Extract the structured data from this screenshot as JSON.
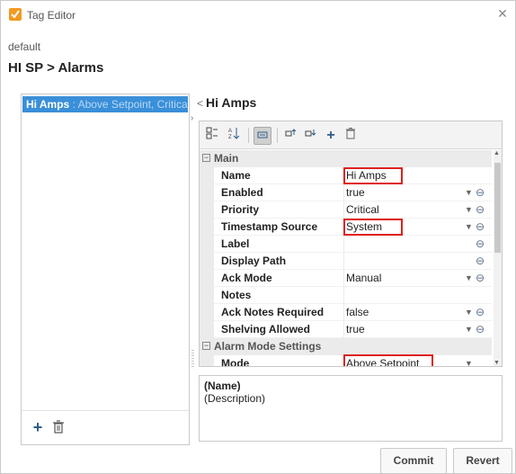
{
  "window": {
    "title": "Tag Editor",
    "close": "✕"
  },
  "path": "default",
  "heading": "HI SP > Alarms",
  "alarms": [
    {
      "name": "Hi Amps",
      "desc": " : Above Setpoint, Critical"
    }
  ],
  "right_title": {
    "arrow": "<",
    "label": "Hi Amps"
  },
  "grid": {
    "main_label": "Main",
    "alarm_mode_label": "Alarm Mode Settings",
    "props": [
      {
        "name": "Name",
        "value": "Hi Amps",
        "dropdown": false,
        "link": false
      },
      {
        "name": "Enabled",
        "value": "true",
        "dropdown": true,
        "link": true
      },
      {
        "name": "Priority",
        "value": "Critical",
        "dropdown": true,
        "link": true
      },
      {
        "name": "Timestamp Source",
        "value": "System",
        "dropdown": true,
        "link": true
      },
      {
        "name": "Label",
        "value": "",
        "dropdown": false,
        "link": true
      },
      {
        "name": "Display Path",
        "value": "",
        "dropdown": false,
        "link": true
      },
      {
        "name": "Ack Mode",
        "value": "Manual",
        "dropdown": true,
        "link": true
      },
      {
        "name": "Notes",
        "value": "",
        "dropdown": false,
        "link": false
      },
      {
        "name": "Ack Notes Required",
        "value": "false",
        "dropdown": true,
        "link": true
      },
      {
        "name": "Shelving Allowed",
        "value": "true",
        "dropdown": true,
        "link": true
      }
    ],
    "mode": {
      "name": "Mode",
      "value": "Above Setpoint"
    }
  },
  "description": {
    "name": "(Name)",
    "text": "(Description)"
  },
  "buttons": {
    "commit": "Commit",
    "revert": "Revert"
  },
  "toolbar_icons": [
    "categorized-icon",
    "sort-alpha-icon",
    "properties-icon",
    "expand-icon",
    "collapse-icon",
    "add-icon",
    "delete-icon"
  ],
  "colors": {
    "selection": "#3a8fd9",
    "highlight": "#e02020",
    "icon": "#f29a22"
  }
}
